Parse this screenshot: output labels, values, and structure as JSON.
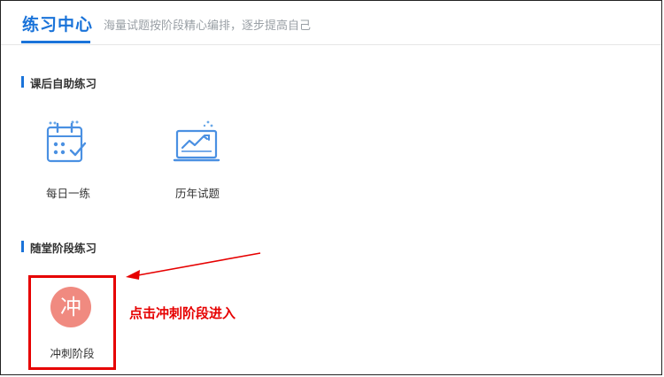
{
  "header": {
    "title": "练习中心",
    "subtitle": "海量试题按阶段精心编排，逐步提高自己"
  },
  "sections": [
    {
      "title": "课后自助练习",
      "items": [
        {
          "label": "每日一练",
          "icon": "calendar-check-icon"
        },
        {
          "label": "历年试题",
          "icon": "chart-board-icon"
        }
      ]
    },
    {
      "title": "随堂阶段练习",
      "items": [
        {
          "label": "冲刺阶段",
          "icon_text": "冲"
        }
      ]
    }
  ],
  "annotation": {
    "text": "点击冲刺阶段进入",
    "color": "#e60000"
  },
  "colors": {
    "accent": "#1a73d9",
    "highlight": "#e60000",
    "circle": "#f08a80"
  }
}
